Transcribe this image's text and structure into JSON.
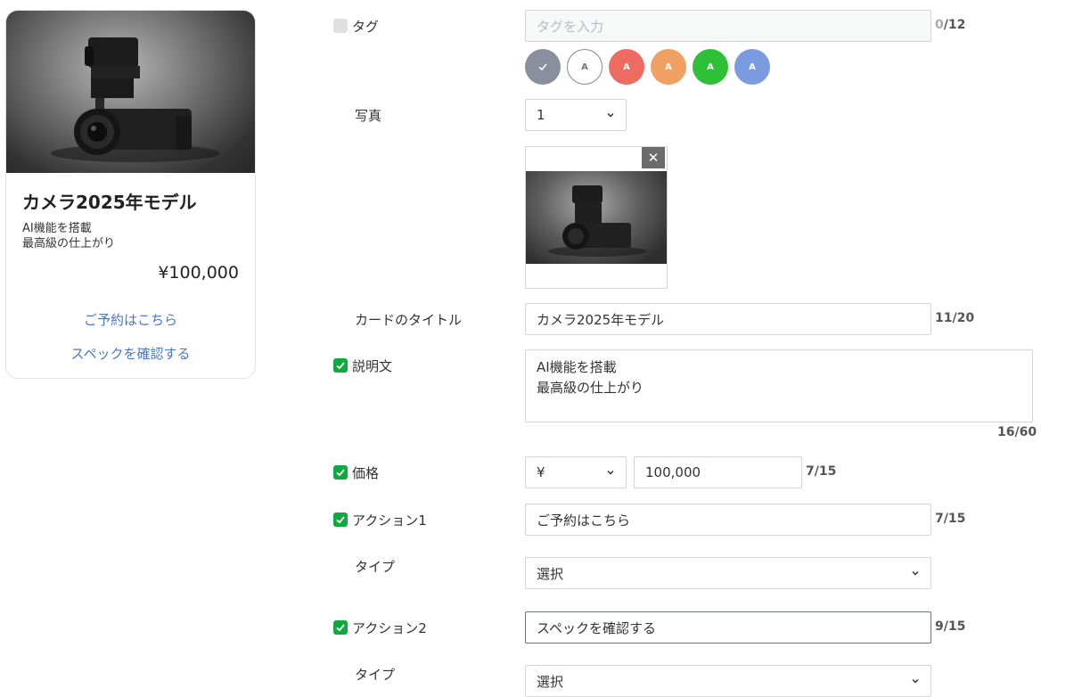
{
  "card": {
    "title": "カメラ2025年モデル",
    "desc_line1": "AI機能を搭載",
    "desc_line2": "最高級の仕上がり",
    "price": "¥100,000",
    "action1": "ご予約はこちら",
    "action2": "スペックを確認する"
  },
  "form": {
    "tag": {
      "label": "タグ",
      "placeholder": "タグを入力",
      "count_current": "0",
      "count_max": "/12",
      "checked": false,
      "swatches": [
        {
          "text": "",
          "color": "#8a8f9e",
          "selected": true
        },
        {
          "text": "A",
          "color": "#ffffff"
        },
        {
          "text": "A",
          "color": "#ee6b61"
        },
        {
          "text": "A",
          "color": "#f0a060"
        },
        {
          "text": "A",
          "color": "#2ec037"
        },
        {
          "text": "A",
          "color": "#7b9be0"
        }
      ]
    },
    "photo": {
      "label": "写真",
      "count": "1",
      "close_symbol": "✕"
    },
    "card_title": {
      "label": "カードのタイトル",
      "value": "カメラ2025年モデル",
      "count": "11/20"
    },
    "description": {
      "label": "説明文",
      "line1": "AI機能を搭載",
      "line2": "最高級の仕上がり",
      "count": "16/60",
      "checked": true
    },
    "price": {
      "label": "価格",
      "currency": "¥",
      "value": "100,000",
      "count": "7/15",
      "checked": true
    },
    "action1": {
      "label": "アクション1",
      "value": "ご予約はこちら",
      "count": "7/15",
      "checked": true,
      "type_label": "タイプ",
      "type_value": "選択"
    },
    "action2": {
      "label": "アクション2",
      "value": "スペックを確認する",
      "count": "9/15",
      "checked": true,
      "type_label": "タイプ",
      "type_value": "選択"
    }
  },
  "colors": {
    "accent_check": "#10a940",
    "link": "#4a78c2"
  }
}
